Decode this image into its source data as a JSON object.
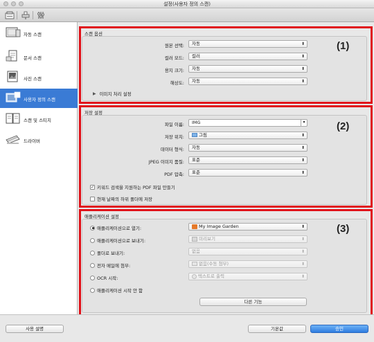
{
  "window": {
    "title": "설정(사용자 정의 스캔)"
  },
  "toolbar": {
    "icons": [
      "scan-settings-icon",
      "scanner-icon",
      "general-settings-icon"
    ]
  },
  "sidebar": {
    "items": [
      {
        "label": "자동 스캔",
        "icon": "auto-scan-icon"
      },
      {
        "label": "문서 스캔",
        "icon": "document-scan-icon"
      },
      {
        "label": "사진 스캔",
        "icon": "photo-scan-icon"
      },
      {
        "label": "사용자 정의 스캔",
        "icon": "custom-scan-icon",
        "selected": true
      },
      {
        "label": "스캔 및 스티치",
        "icon": "scan-stitch-icon"
      },
      {
        "label": "드라이버",
        "icon": "driver-icon"
      }
    ]
  },
  "scan_options": {
    "title": "스캔 옵션",
    "number": "(1)",
    "rows": [
      {
        "label": "원본 선택:",
        "value": "자동"
      },
      {
        "label": "컬러 모드:",
        "value": "컬러"
      },
      {
        "label": "용지 크기:",
        "value": "자동"
      },
      {
        "label": "해상도:",
        "value": "자동"
      }
    ],
    "image_processing": "이미지 처리 설정"
  },
  "save_settings": {
    "title": "저장 설정",
    "number": "(2)",
    "file_name": {
      "label": "파일 이름:",
      "value": "IMG"
    },
    "rows": [
      {
        "label": "저장 위치:",
        "value": "그림"
      },
      {
        "label": "데이터 형식:",
        "value": "자동"
      },
      {
        "label": "JPEG 이미지 품질:",
        "value": "표준"
      },
      {
        "label": "PDF 압축:",
        "value": "표준"
      }
    ],
    "checkbox_pdf": {
      "label": "키워드 검색을 지원하는 PDF 파일 만들기",
      "checked": true
    },
    "checkbox_subfolder": {
      "label": "현재 날짜의 하위 폴더에 저장",
      "checked": false
    }
  },
  "app_settings": {
    "title": "애플리케이션 설정",
    "number": "(3)",
    "options": [
      {
        "label": "애플리케이션으로 열기:",
        "value": "My Image Garden",
        "selected": true,
        "enabled": true
      },
      {
        "label": "애플리케이션으로 보내기:",
        "value": "미리보기",
        "selected": false,
        "enabled": false
      },
      {
        "label": "폴더로 보내기:",
        "value": "없음",
        "selected": false,
        "enabled": false
      },
      {
        "label": "전자 메일에 첨부:",
        "value": "없음(수동 첨부)",
        "selected": false,
        "enabled": false
      },
      {
        "label": "OCR 시작:",
        "value": "텍스트로 출력",
        "selected": false,
        "enabled": false
      },
      {
        "label": "애플리케이션 시작 안 함",
        "selected": false
      }
    ],
    "more_functions": "다른 기능"
  },
  "footer": {
    "help": "사용 설명",
    "defaults": "기본값",
    "ok": "승인"
  },
  "colors": {
    "accent": "#3a7bd5",
    "highlight_border": "#e0121a"
  }
}
